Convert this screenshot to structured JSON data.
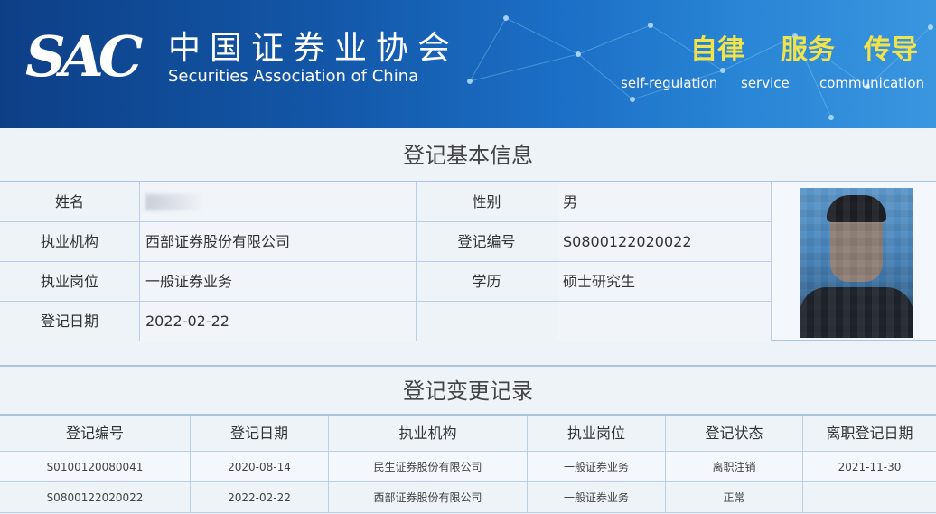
{
  "header": {
    "logo_text": "SAC",
    "org_name_cn": "中国证券业协会",
    "org_name_en": "Securities Association of China",
    "slogans": [
      {
        "cn": "自律",
        "en": "self-regulation"
      },
      {
        "cn": "服务",
        "en": "service"
      },
      {
        "cn": "传导",
        "en": "communication"
      }
    ]
  },
  "basic_info": {
    "title": "登记基本信息",
    "name_label": "姓名",
    "gender_label": "性别",
    "gender_value": "男",
    "org_label": "执业机构",
    "org_value": "西部证券股份有限公司",
    "reg_no_label": "登记编号",
    "reg_no_value": "S0800122020022",
    "position_label": "执业岗位",
    "position_value": "一般证券业务",
    "edu_label": "学历",
    "edu_value": "硕士研究生",
    "reg_date_label": "登记日期",
    "reg_date_value": "2022-02-22"
  },
  "change_records": {
    "title": "登记变更记录",
    "columns": [
      "登记编号",
      "登记日期",
      "执业机构",
      "执业岗位",
      "登记状态",
      "离职登记日期"
    ],
    "rows": [
      [
        "S0100120080041",
        "2020-08-14",
        "民生证券股份有限公司",
        "一般证券业务",
        "离职注销",
        "2021-11-30"
      ],
      [
        "S0800122020022",
        "2022-02-22",
        "西部证券股份有限公司",
        "一般证券业务",
        "正常",
        ""
      ]
    ]
  },
  "colors": {
    "banner_dark": "#0d3f86",
    "banner_light": "#3a96df",
    "slogan_yellow": "#f2e34a",
    "border_blue": "#a9c3e3"
  }
}
